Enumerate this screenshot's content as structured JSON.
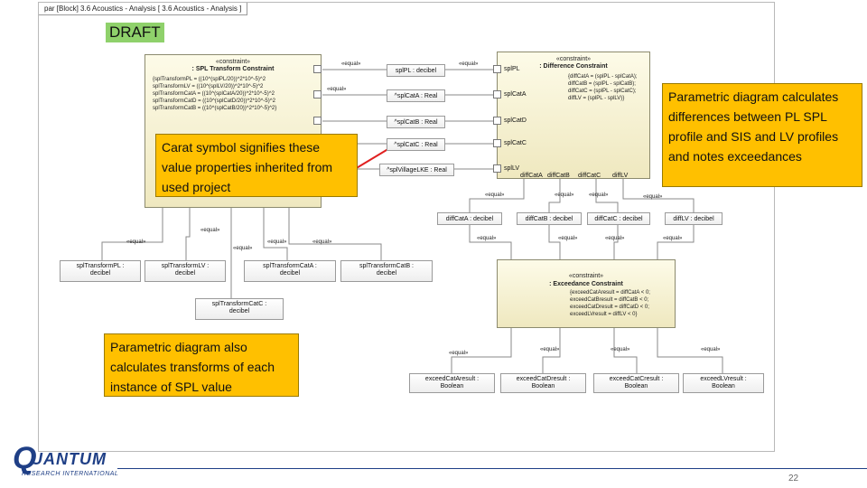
{
  "frame": {
    "tab_label": "par [Block] 3.6 Acoustics - Analysis [ 3.6 Acoustics - Analysis ]"
  },
  "draft_label": "DRAFT",
  "spl_transform_constraint": {
    "stereotype": "«constraint»",
    "name": ": SPL Transform Constraint",
    "equations": [
      "{splTransformPL = ((10^(splPL/20))^2*10^-5)^2",
      "splTransformLV = ((10^(splLV/20))^2*10^-5)^2",
      "splTransformCatA = ((10^(splCatA/20))^2*10^-5)^2",
      "splTransformCatD = ((10^(splCatD/20))^2*10^-5)^2",
      "splTransformCatB = ((10^(splCatB/20))^2*10^-5)^2}"
    ]
  },
  "difference_constraint": {
    "stereotype": "«constraint»",
    "name": ": Difference Constraint",
    "equations": [
      "{diffCatA = (splPL - splCatA);",
      "diffCatB = (splPL - splCatB);",
      "diffCatC = (splPL - splCatC);",
      "diffLV = (splPL - splLV)}"
    ],
    "ports_left": [
      "splPL",
      "splCatA",
      "splCatD",
      "splCatC",
      "splLV"
    ],
    "ports_bottom": [
      "diffCatA",
      "diffCatB",
      "diffCatC",
      "diffLV"
    ]
  },
  "exceedance_constraint": {
    "stereotype": "«constraint»",
    "name": ": Exceedance Constraint",
    "equations": [
      "{exceedCatAresult = diffCatA < 0;",
      "exceedCatBresult = diffCatB < 0;",
      "exceedCatDresult = diffCatD < 0;",
      "exceedLVresult = diffLV < 0}"
    ]
  },
  "value_properties": [
    {
      "id": "splPL",
      "label": "splPL : decibel"
    },
    {
      "id": "splCatA",
      "label": "^splCatA : Real"
    },
    {
      "id": "splCatB",
      "label": "^splCatB : Real"
    },
    {
      "id": "splCatC",
      "label": "^splCatC : Real"
    },
    {
      "id": "splVillageLKE",
      "label": "^splVillageLKE : Real"
    }
  ],
  "diff_properties": [
    "diffCatA : decibel",
    "diffCatB : decibel",
    "diffCatC : decibel",
    "diffLV : decibel"
  ],
  "transform_properties": [
    {
      "line1": "splTransformPL :",
      "line2": "decibel"
    },
    {
      "line1": "splTransformLV :",
      "line2": "decibel"
    },
    {
      "line1": "splTransformCatA :",
      "line2": "decibel"
    },
    {
      "line1": "splTransformCatB :",
      "line2": "decibel"
    },
    {
      "line1": "splTransformCatC :",
      "line2": "decibel"
    }
  ],
  "result_properties": [
    {
      "line1": "exceedCatAresult :",
      "line2": "Boolean"
    },
    {
      "line1": "exceedCatDresult :",
      "line2": "Boolean"
    },
    {
      "line1": "exceedCatCresult :",
      "line2": "Boolean"
    },
    {
      "line1": "exceedLVresult :",
      "line2": "Boolean"
    }
  ],
  "equal_label": "«equal»",
  "callouts": {
    "carat": "Carat symbol signifies these value properties inherited from used project",
    "transforms": "Parametric diagram also calculates transforms of each instance of SPL value",
    "differences": "Parametric diagram calculates differences between PL SPL profile and SIS and LV profiles and notes exceedances"
  },
  "logo": {
    "name": "UANTUM",
    "letter": "Q",
    "sub": "RESEARCH INTERNATIONAL"
  },
  "page_number": "22"
}
